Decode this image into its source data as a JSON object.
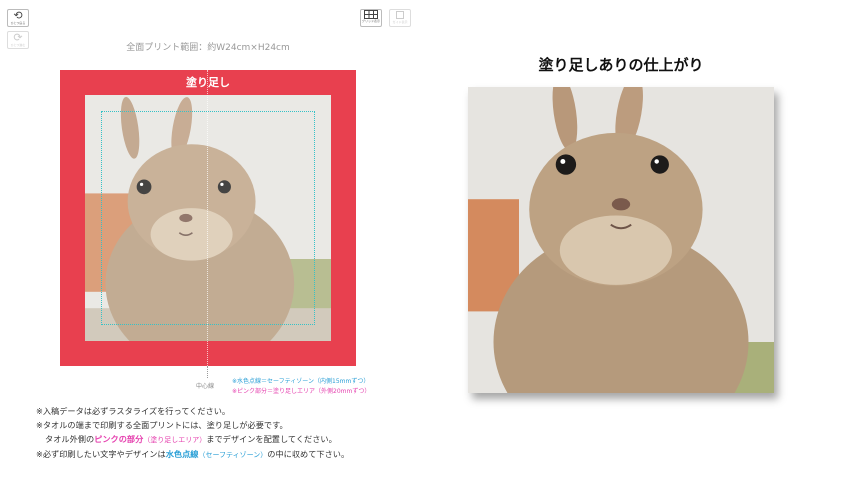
{
  "toolbar": {
    "undo_label": "ひとつ戻る",
    "redo_label": "ひとつ進む",
    "grid_label": "グリッド表示",
    "guide_label": "ガイド表示"
  },
  "editor": {
    "range_label": "全面プリント範囲：約W24cm×H24cm",
    "bleed_title": "塗り足し",
    "center_line_label": "中心線"
  },
  "legend": {
    "line1": "※水色点線＝セーフティゾーン（内側15mmずつ）",
    "line2": "※ピンク部分＝塗り足しエリア（外側20mmずつ）"
  },
  "notes": {
    "n1": "※入稿データは必ずラスタライズを行ってください。",
    "n2": "※タオルの端まで印刷する全面プリントには、塗り足しが必要です。",
    "n3_prefix": "タオル外側の",
    "n3_pink": "ピンクの部分",
    "n3_pink_small": "（塗り足しエリア）",
    "n3_suffix": "までデザインを配置してください。",
    "n4_prefix": "※必ず印刷したい文字やデザインは",
    "n4_aqua": "水色点線",
    "n4_aqua_small": "（セーフティゾーン）",
    "n4_suffix": "の中に収めて下さい。"
  },
  "preview": {
    "title": "塗り足しありの仕上がり"
  },
  "colors": {
    "bleed": "#e8404f",
    "safe_line": "#35c2c7",
    "pink_text": "#e53fae",
    "aqua_text": "#2a9fd6"
  },
  "icons": [
    "undo-icon",
    "redo-icon",
    "grid-icon",
    "guide-frame-icon"
  ]
}
